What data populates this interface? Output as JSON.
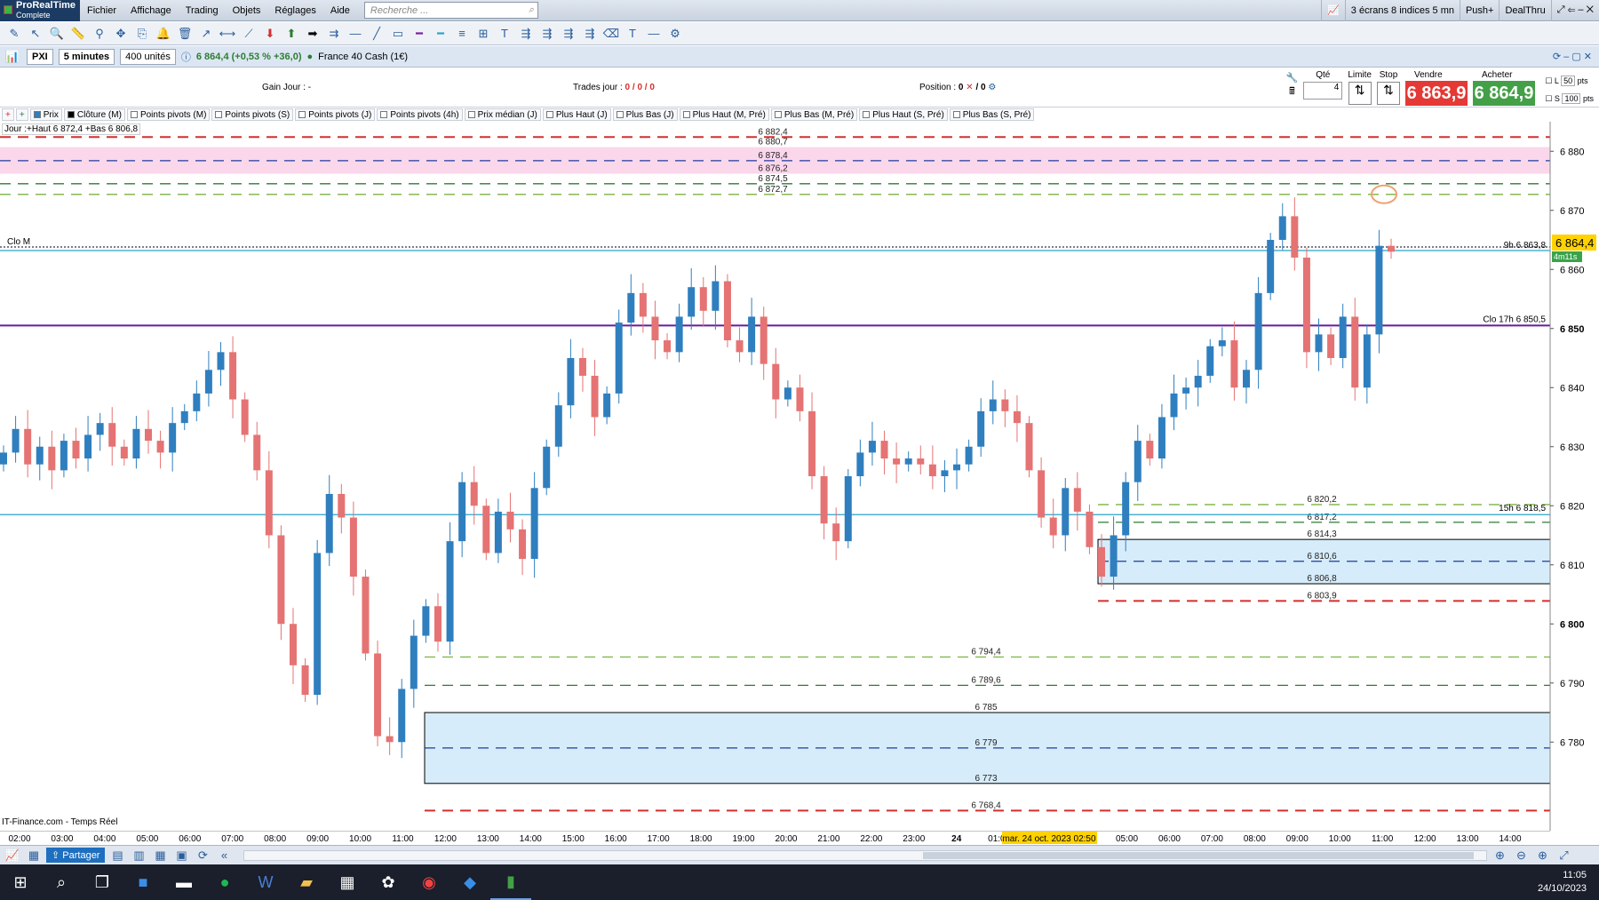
{
  "app": {
    "brand_line1": "ProRealTime",
    "brand_line2": "Complete"
  },
  "menu": [
    "Fichier",
    "Affichage",
    "Trading",
    "Objets",
    "Réglages",
    "Aide"
  ],
  "search": {
    "placeholder": "Recherche ..."
  },
  "menu_right": {
    "screens": "3 écrans 8 indices 5 mn",
    "push": "Push+",
    "dealthru": "DealThru"
  },
  "chartbar": {
    "symbol": "PXI",
    "timeframe": "5 minutes",
    "units": "400 unités",
    "quote": "6 864,4 (+0,53 % +36,0)",
    "instrument": "France 40 Cash (1€)"
  },
  "info": {
    "gain_label": "Gain Jour :",
    "gain_value": "-",
    "trades_label": "Trades jour :",
    "trades_value": "0 / 0 / 0",
    "position_label": "Position :",
    "position_value": "0",
    "position_value2": "/ 0",
    "qty_label": "Qté",
    "qty_value": "4",
    "limit_label": "Limite",
    "stop_label": "Stop",
    "sell_label": "Vendre",
    "sell_price": "6 863,9",
    "buy_label": "Acheter",
    "buy_price": "6 864,9",
    "l_label": "L",
    "l_value": "50",
    "s_label": "S",
    "s_value": "100",
    "pts": "pts"
  },
  "legend": [
    "Prix",
    "Clôture (M)",
    "Points pivots (M)",
    "Points pivots (S)",
    "Points pivots (J)",
    "Points pivots (4h)",
    "Prix médian (J)",
    "Plus Haut (J)",
    "Plus Bas (J)",
    "Plus Haut (M, Pré)",
    "Plus Bas (M, Pré)",
    "Plus Haut (S, Pré)",
    "Plus Bas (S, Pré)"
  ],
  "day_range": "Jour :+Haut 6 872,4 +Bas 6 806,8",
  "source": "IT-Finance.com - Temps Réel",
  "chart_data": {
    "type": "candlestick",
    "ylim": [
      6765,
      6885
    ],
    "yticks": [
      "6 880",
      "6 870",
      "6 860",
      "6 850",
      "6 840",
      "6 830",
      "6 820",
      "6 810",
      "6 800",
      "6 790",
      "6 780"
    ],
    "ytick_values": [
      6880,
      6870,
      6860,
      6850,
      6840,
      6830,
      6820,
      6810,
      6800,
      6790,
      6780
    ],
    "current_price": "6 864,4",
    "countdown": "4m11s",
    "xticks": [
      "02:00",
      "03:00",
      "04:00",
      "05:00",
      "06:00",
      "07:00",
      "08:00",
      "09:00",
      "10:00",
      "11:00",
      "12:00",
      "13:00",
      "14:00",
      "15:00",
      "16:00",
      "17:00",
      "18:00",
      "19:00",
      "20:00",
      "21:00",
      "22:00",
      "23:00",
      "24",
      "01:00",
      "",
      "",
      "05:00",
      "06:00",
      "07:00",
      "08:00",
      "09:00",
      "10:00",
      "11:00",
      "12:00",
      "13:00",
      "14:00"
    ],
    "cursor_time": "mar. 24 oct. 2023 02:50",
    "close_series": [
      6829,
      6833,
      6827,
      6830,
      6826,
      6831,
      6828,
      6832,
      6834,
      6830,
      6828,
      6833,
      6831,
      6829,
      6834,
      6836,
      6839,
      6843,
      6846,
      6838,
      6832,
      6826,
      6815,
      6800,
      6793,
      6788,
      6812,
      6822,
      6818,
      6808,
      6795,
      6781,
      6780,
      6789,
      6798,
      6803,
      6797,
      6814,
      6824,
      6820,
      6812,
      6819,
      6816,
      6811,
      6823,
      6830,
      6837,
      6845,
      6842,
      6835,
      6839,
      6851,
      6856,
      6852,
      6848,
      6846,
      6852,
      6857,
      6853,
      6858,
      6848,
      6846,
      6852,
      6844,
      6838,
      6840,
      6836,
      6825,
      6817,
      6814,
      6825,
      6829,
      6831,
      6828,
      6827,
      6828,
      6827,
      6825,
      6826,
      6827,
      6830,
      6836,
      6838,
      6836,
      6834,
      6826,
      6818,
      6815,
      6823,
      6819,
      6813,
      6808,
      6815,
      6824,
      6831,
      6828,
      6835,
      6839,
      6840,
      6842,
      6847,
      6848,
      6840,
      6843,
      6856,
      6865,
      6869,
      6862,
      6846,
      6849,
      6845,
      6852,
      6840,
      6849,
      6864,
      6863
    ],
    "levels": [
      {
        "label": "6 882,4",
        "value": 6882.4,
        "color": "#d32f2f"
      },
      {
        "label": "6 880,7",
        "value": 6880.7,
        "color": "#333333"
      },
      {
        "label": "6 878,4",
        "value": 6878.4,
        "color": "#1e3c9a"
      },
      {
        "label": "6 876,2",
        "value": 6876.2,
        "color": "#333333"
      },
      {
        "label": "6 874,5",
        "value": 6874.5,
        "color": "#2e7d32"
      },
      {
        "label": "6 872,7",
        "value": 6872.7,
        "color": "#7cb342"
      },
      {
        "label": "6 820,2",
        "value": 6820.2,
        "color": "#7cb342"
      },
      {
        "label": "6 817,2",
        "value": 6817.2,
        "color": "#2e7d32"
      },
      {
        "label": "6 814,3",
        "value": 6814.3,
        "color": "#333333"
      },
      {
        "label": "6 810,6",
        "value": 6810.6,
        "color": "#1e3c9a"
      },
      {
        "label": "6 806,8",
        "value": 6806.8,
        "color": "#333333"
      },
      {
        "label": "6 803,9",
        "value": 6803.9,
        "color": "#d32f2f"
      },
      {
        "label": "6 794,4",
        "value": 6794.4,
        "color": "#7cb342"
      },
      {
        "label": "6 789,6",
        "value": 6789.6,
        "color": "#2e7d32"
      },
      {
        "label": "6 785",
        "value": 6785,
        "color": "#333333"
      },
      {
        "label": "6 779",
        "value": 6779,
        "color": "#1e3c9a"
      },
      {
        "label": "6 773",
        "value": 6773,
        "color": "#333333"
      },
      {
        "label": "6 768,4",
        "value": 6768.4,
        "color": "#d32f2f"
      }
    ],
    "ref_lines": [
      {
        "label": "Clo M",
        "value": 6863.8,
        "color": "#000000"
      },
      {
        "label": "9h 6 863,8",
        "value": 6863.2,
        "color": "#2aa3c9"
      },
      {
        "label": "Clo 17h 6 850,5",
        "value": 6850.5,
        "color": "#6a1b9a"
      },
      {
        "label": "15h 6 818,5",
        "value": 6818.5,
        "color": "#2aa3c9"
      }
    ]
  },
  "bottombar": {
    "share": "Partager"
  },
  "taskbar": {
    "time": "11:05",
    "date": "24/10/2023"
  },
  "colors": {
    "up": "#2f7fbf",
    "down": "#e57373",
    "sell": "#e53935",
    "buy": "#43a047"
  }
}
